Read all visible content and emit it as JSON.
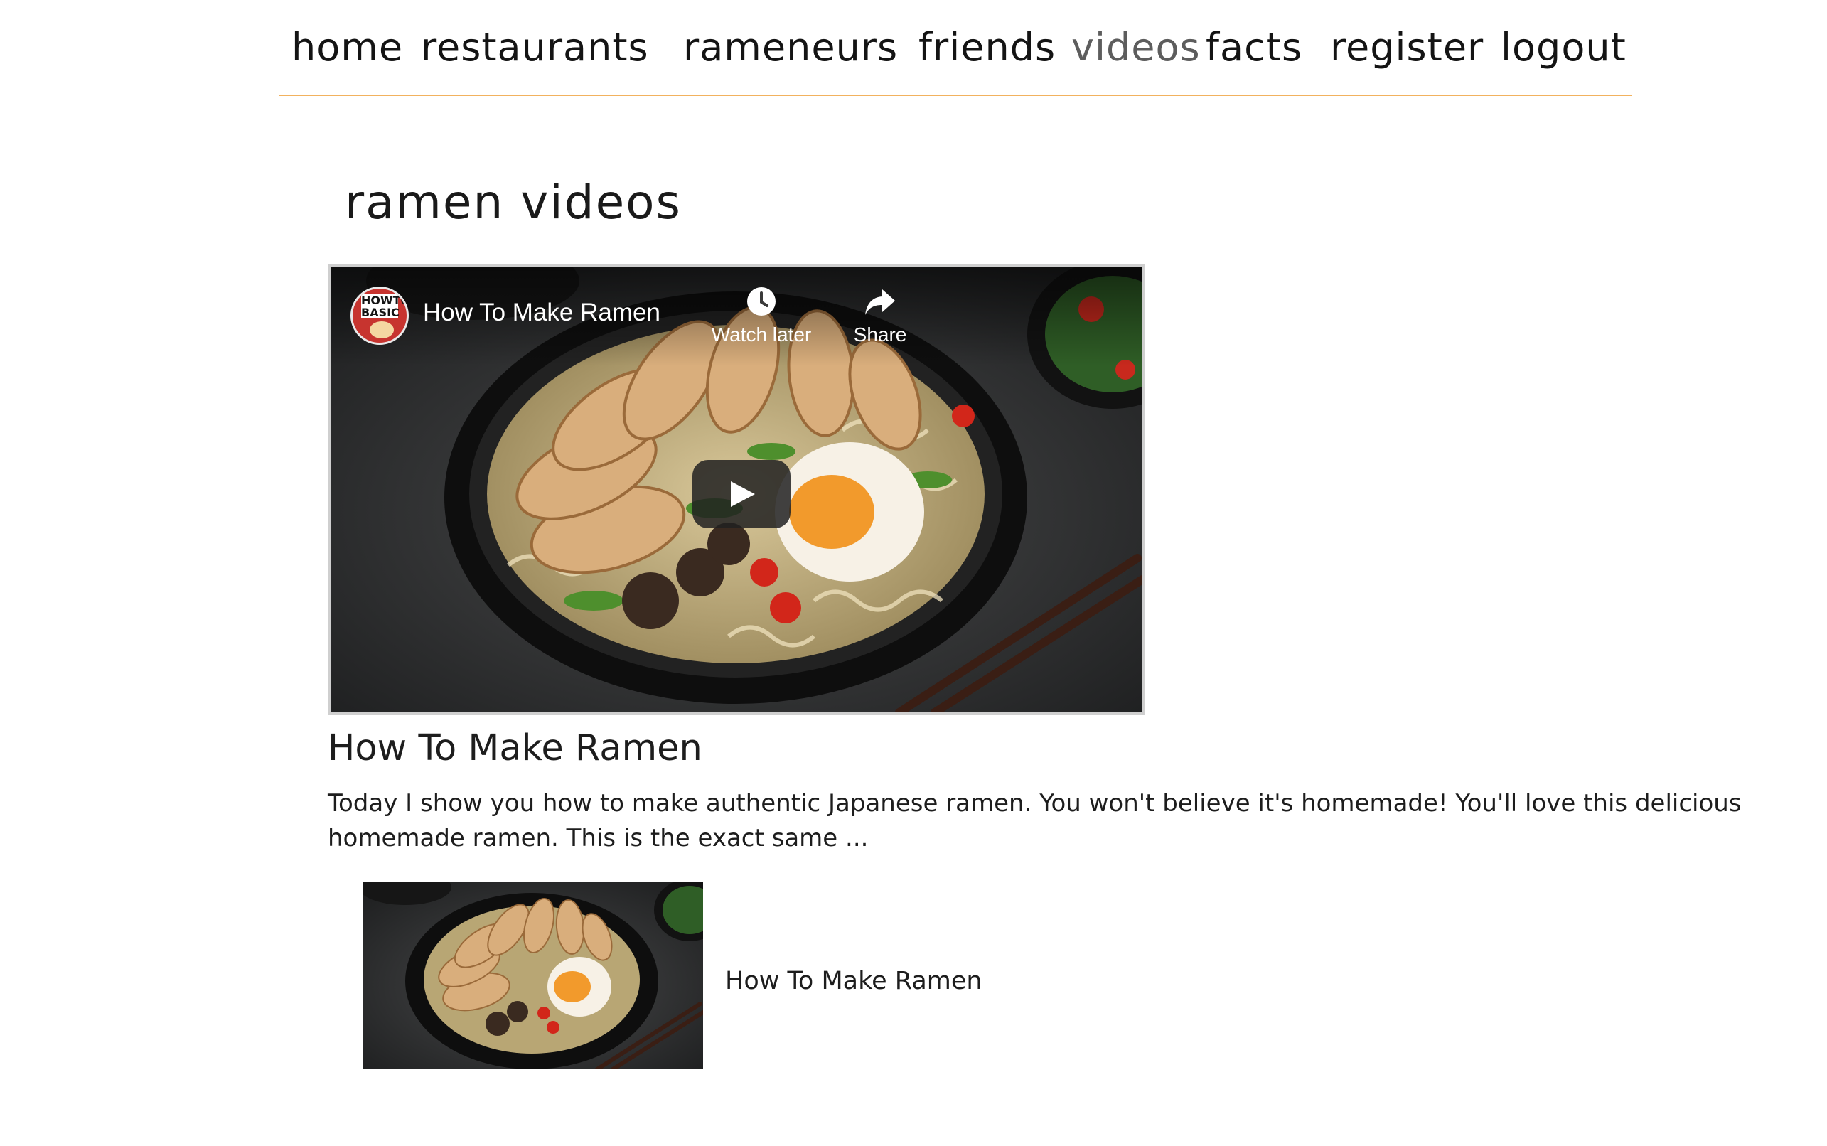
{
  "nav": {
    "items": [
      {
        "label": "home"
      },
      {
        "label": "restaurants"
      },
      {
        "label": "rameneurs"
      },
      {
        "label": "friends"
      },
      {
        "label": "videos",
        "active": true
      },
      {
        "label": "facts"
      },
      {
        "label": "register"
      },
      {
        "label": "logout"
      }
    ]
  },
  "page": {
    "title": "ramen videos"
  },
  "player": {
    "channel_badge_line1": "HOWTO",
    "channel_badge_line2": "BASIC",
    "video_title": "How To Make Ramen",
    "watch_later_label": "Watch later",
    "share_label": "Share",
    "play_icon": "play-icon",
    "clock_icon": "clock-icon",
    "share_icon": "share-arrow-icon"
  },
  "video": {
    "title": "How To Make Ramen",
    "description": "Today I show you how to make authentic Japanese ramen. You won't believe it's homemade! You'll love this delicious homemade ramen. This is the exact same ..."
  },
  "list": {
    "items": [
      {
        "title": "How To Make Ramen"
      }
    ]
  },
  "colors": {
    "nav_divider": "#f2b25e",
    "text": "#1d1d1d",
    "active_nav": "#5d5d5d"
  }
}
